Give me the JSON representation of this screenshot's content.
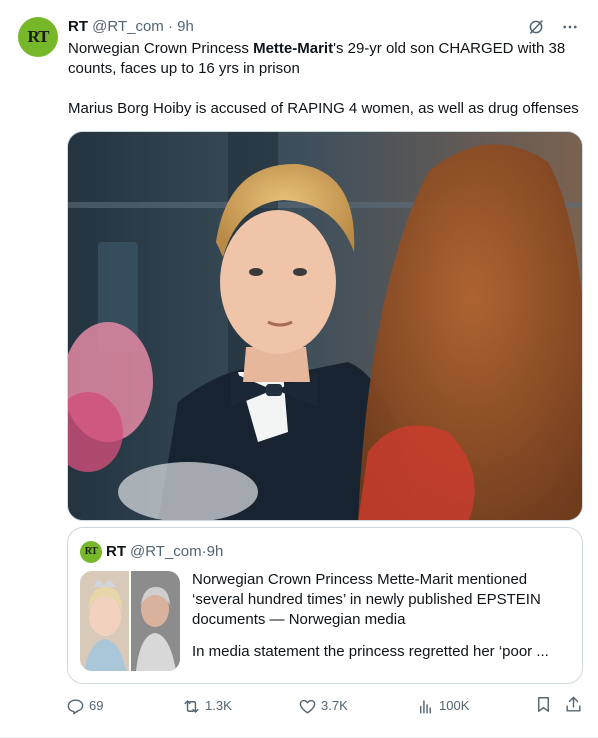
{
  "tweet": {
    "avatar_text": "RT",
    "author_name": "RT",
    "author_handle": "@RT_com",
    "separator": "·",
    "time": "9h",
    "text_line1_pre": "Norwegian Crown Princess ",
    "text_line1_bold": "Mette-Marit",
    "text_line1_post": "'s 29-yr old son CHARGED with 38 counts, faces up to 16 yrs in prison",
    "text_line2": "Marius Borg Hoiby is accused of RAPING 4 women, as well as drug offenses",
    "header_icons": [
      "grok-icon",
      "more-icon"
    ]
  },
  "quote": {
    "avatar_text": "RT",
    "author_name": "RT",
    "author_handle": "@RT_com",
    "separator": "·",
    "time": "9h",
    "text1": "Norwegian Crown Princess Mette-Marit mentioned ‘several hundred times’ in newly published EPSTEIN documents — Norwegian media",
    "text2": "In media statement the princess regretted her ‘poor ..."
  },
  "actions": {
    "replies": "69",
    "reposts": "1.3K",
    "likes": "3.7K",
    "views": "100K",
    "icons": [
      "reply-icon",
      "repost-icon",
      "like-icon",
      "views-icon",
      "bookmark-icon",
      "share-icon"
    ]
  },
  "colors": {
    "brand_green": "#77b82a",
    "muted": "#536471",
    "border": "#cfd9de"
  }
}
